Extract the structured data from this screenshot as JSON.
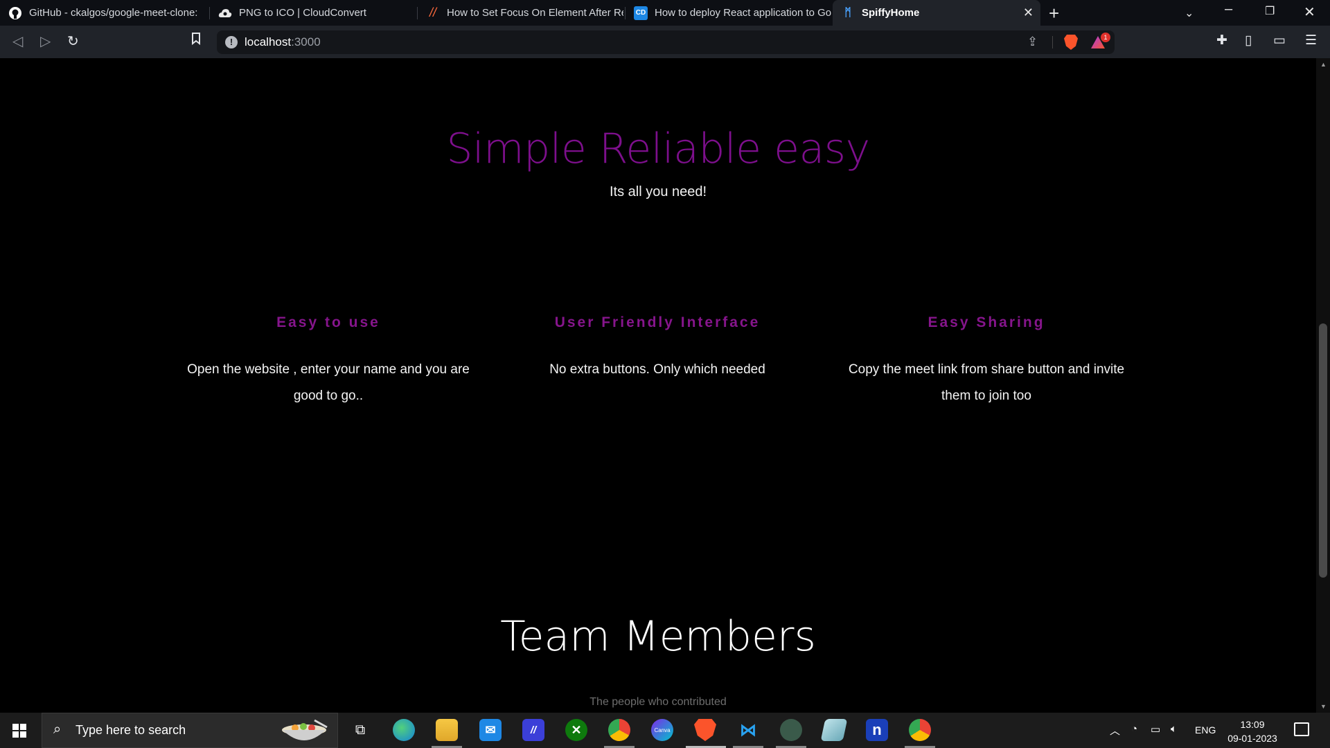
{
  "browser": {
    "tabs": [
      {
        "title": "GitHub - ckalgos/google-meet-clone:",
        "icon": "github-icon"
      },
      {
        "title": "PNG to ICO | CloudConvert",
        "icon": "cloudconvert-icon"
      },
      {
        "title": "How to Set Focus On Element After Re",
        "icon": "hashnode-icon"
      },
      {
        "title": "How to deploy React application to Go",
        "icon": "cd-icon",
        "icon_text": "CD"
      },
      {
        "title": "SpiffyHome",
        "icon": "spiffy-icon",
        "active": true
      }
    ],
    "url": {
      "host": "localhost",
      "port": ":3000"
    },
    "notification_count": "1"
  },
  "page": {
    "hero": {
      "title": "Simple Reliable easy",
      "subtitle": "Its all you need!"
    },
    "features": [
      {
        "title": "Easy to use",
        "text": "Open the website , enter your name and you are good to go.."
      },
      {
        "title": "User Friendly Interface",
        "text": "No extra buttons. Only which needed"
      },
      {
        "title": "Easy Sharing",
        "text": "Copy the meet link from share button and invite them to join too"
      }
    ],
    "team": {
      "title": "Team Members",
      "subtitle": "The people who contributed"
    }
  },
  "taskbar": {
    "search_placeholder": "Type here to search",
    "language": "ENG",
    "time": "13:09",
    "date": "09-01-2023",
    "canva_label": "Canva",
    "notion_label": "n"
  },
  "colors": {
    "accent_purple": "#7d0f8c",
    "feature_purple": "#86158c",
    "page_bg": "#000000"
  }
}
